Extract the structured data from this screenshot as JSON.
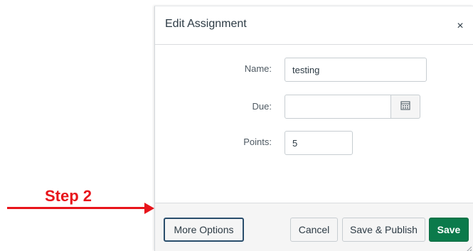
{
  "annotation": {
    "step_text": "Step 2",
    "color": "#e8141b"
  },
  "dialog": {
    "title": "Edit Assignment",
    "close_glyph": "×",
    "fields": {
      "name": {
        "label": "Name:",
        "value": "testing"
      },
      "due": {
        "label": "Due:",
        "value": "",
        "icon": "calendar-icon"
      },
      "points": {
        "label": "Points:",
        "value": "5"
      }
    },
    "footer": {
      "more_options": "More Options",
      "cancel": "Cancel",
      "save_publish": "Save & Publish",
      "save": "Save"
    },
    "colors": {
      "primary": "#0b7a4b",
      "focus_border": "#2a4e6c"
    }
  }
}
